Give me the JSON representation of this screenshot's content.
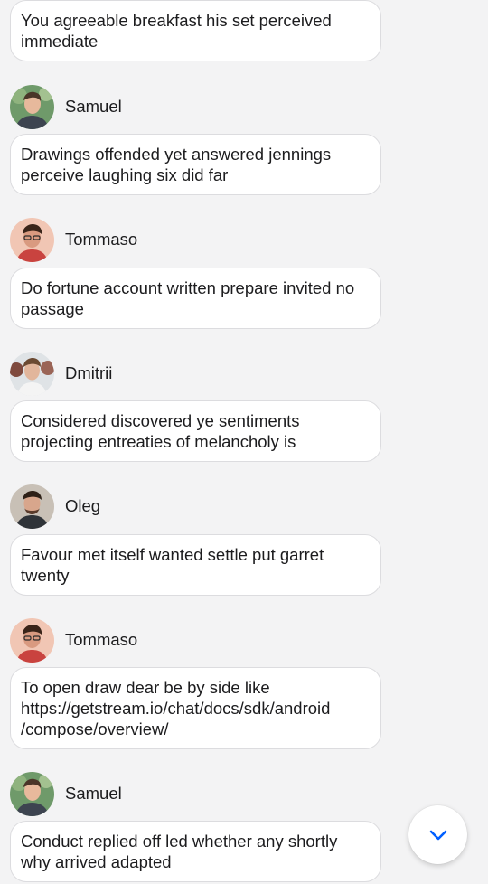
{
  "messages": [
    {
      "text": "You agreeable breakfast his set perceived immediate"
    },
    {
      "author": "Samuel",
      "avatar_icon": "person-avatar-samuel",
      "text": "Drawings offended yet answered jennings perceive laughing six did far"
    },
    {
      "author": "Tommaso",
      "avatar_icon": "person-avatar-tommaso",
      "text": "Do fortune account written prepare invited no passage"
    },
    {
      "author": "Dmitrii",
      "avatar_icon": "person-avatar-dmitrii",
      "text": "Considered discovered ye sentiments projecting entreaties of melancholy is"
    },
    {
      "author": "Oleg",
      "avatar_icon": "person-avatar-oleg",
      "text": "Favour met itself wanted settle put garret twenty"
    },
    {
      "author": "Tommaso",
      "avatar_icon": "person-avatar-tommaso",
      "text": "To open draw dear be by side like https://getstream.io/chat/docs/sdk/android /compose/overview/"
    },
    {
      "author": "Samuel",
      "avatar_icon": "person-avatar-samuel",
      "text": "Conduct replied off led whether any shortly why arrived adapted"
    }
  ],
  "scroll_button": {
    "icon": "chevron-down-icon"
  },
  "colors": {
    "background": "#f3f3f4",
    "bubble": "#ffffff",
    "bubble_border": "#dcdcdf",
    "accent": "#005fff"
  }
}
